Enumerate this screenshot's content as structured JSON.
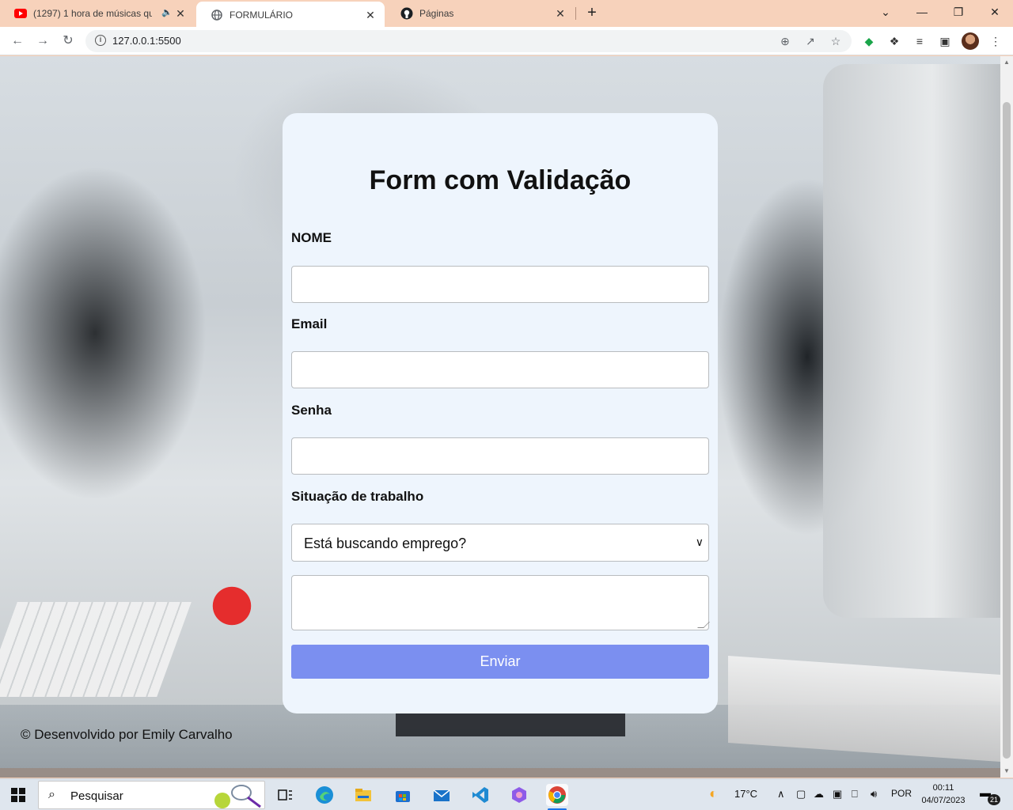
{
  "browser": {
    "tabs": [
      {
        "title": "(1297) 1 hora de músicas qu",
        "favicon": "youtube-icon",
        "audio": true
      },
      {
        "title": "FORMULÁRIO",
        "favicon": "globe-icon",
        "active": true
      },
      {
        "title": "Páginas",
        "favicon": "github-icon"
      }
    ],
    "new_tab_label": "+",
    "url": "127.0.0.1:5500"
  },
  "page": {
    "title": "Form com Validação",
    "fields": {
      "nome_label": "NOME",
      "nome_value": "",
      "email_label": "Email",
      "email_value": "",
      "senha_label": "Senha",
      "senha_value": "",
      "situacao_label": "Situação de trabalho",
      "situacao_selected": "Está buscando emprego?",
      "textarea_value": ""
    },
    "submit_label": "Enviar",
    "footer": "© Desenvolvido por Emily Carvalho"
  },
  "taskbar": {
    "search_placeholder": "Pesquisar",
    "weather": "17°C",
    "language": "POR",
    "time": "00:11",
    "date": "04/07/2023",
    "notification_count": "21",
    "apps": [
      "task-view-icon",
      "edge-icon",
      "file-explorer-icon",
      "store-icon",
      "mail-icon",
      "vscode-icon",
      "copilot-icon",
      "chrome-icon"
    ]
  },
  "colors": {
    "tabstrip": "#f7d2bb",
    "card": "#eef5fd",
    "submit_button": "#7b8ff0"
  }
}
